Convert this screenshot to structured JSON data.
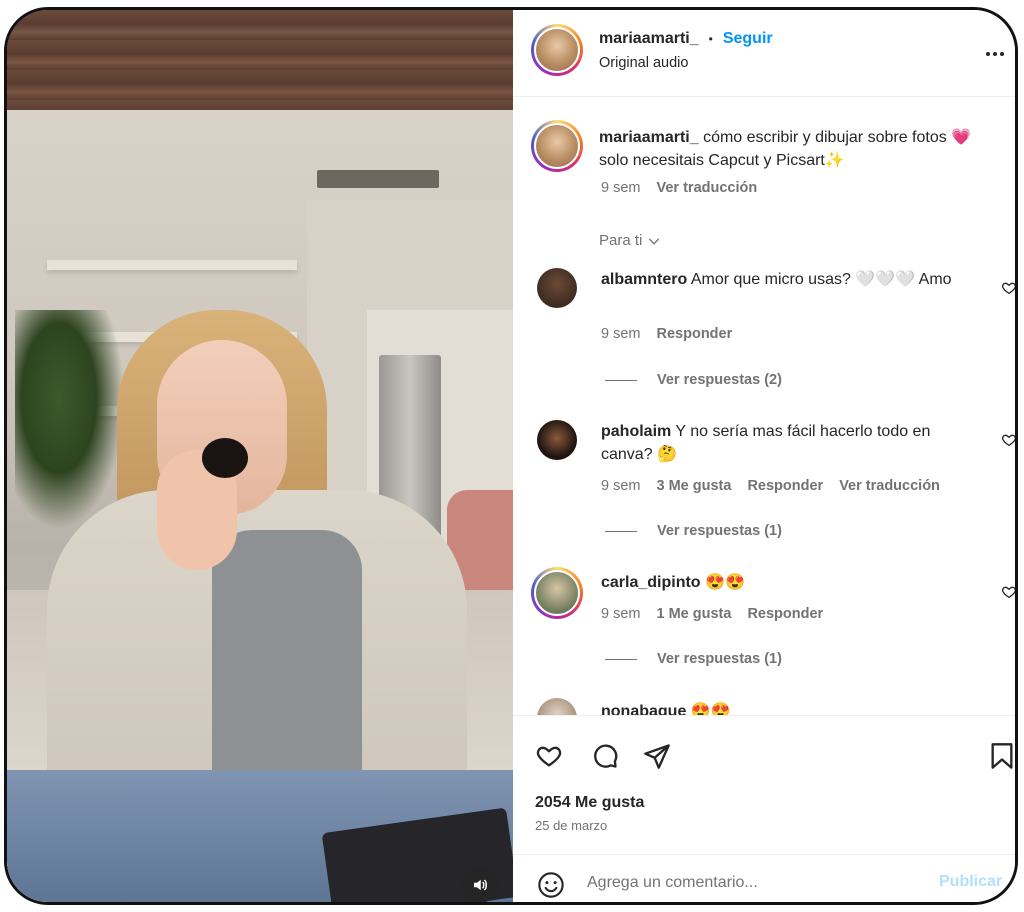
{
  "header": {
    "username": "mariaamarti_",
    "dot": "•",
    "follow_label": "Seguir",
    "audio_label": "Original audio",
    "more_icon": "more-horizontal-icon"
  },
  "caption": {
    "username": "mariaamarti_",
    "text": "cómo escribir y dibujar sobre fotos 💗 solo necesitais Capcut y Picsart✨",
    "time": "9 sem",
    "translate_label": "Ver traducción"
  },
  "sort_label": "Para ti",
  "comments": [
    {
      "username": "albamntero",
      "text": "Amor que micro usas? 🤍🤍🤍 Amo",
      "time": "9 sem",
      "likes": "",
      "reply_label": "Responder",
      "translate_label": "",
      "view_replies": "Ver respuestas (2)"
    },
    {
      "username": "paholaim",
      "text": "Y no sería mas fácil hacerlo todo en canva? 🤔",
      "time": "9 sem",
      "likes": "3 Me gusta",
      "reply_label": "Responder",
      "translate_label": "Ver traducción",
      "view_replies": "Ver respuestas (1)"
    },
    {
      "username": "carla_dipinto",
      "text": "😍😍",
      "time": "9 sem",
      "likes": "1 Me gusta",
      "reply_label": "Responder",
      "translate_label": "",
      "view_replies": "Ver respuestas (1)"
    },
    {
      "username": "nonabaque",
      "text": "😍😍"
    }
  ],
  "actions": {
    "like_icon": "heart-icon",
    "comment_icon": "comment-icon",
    "share_icon": "send-icon",
    "save_icon": "bookmark-icon",
    "likes_count": "2054 Me gusta",
    "date": "25 de marzo"
  },
  "comment_box": {
    "emoji_icon": "emoji-icon",
    "placeholder": "Agrega un comentario...",
    "publish_label": "Publicar"
  },
  "video": {
    "mute_icon": "volume-icon"
  },
  "colors": {
    "accent": "#0095f6",
    "text": "#262626",
    "muted": "#737373",
    "publish_disabled": "#b2dffc"
  }
}
